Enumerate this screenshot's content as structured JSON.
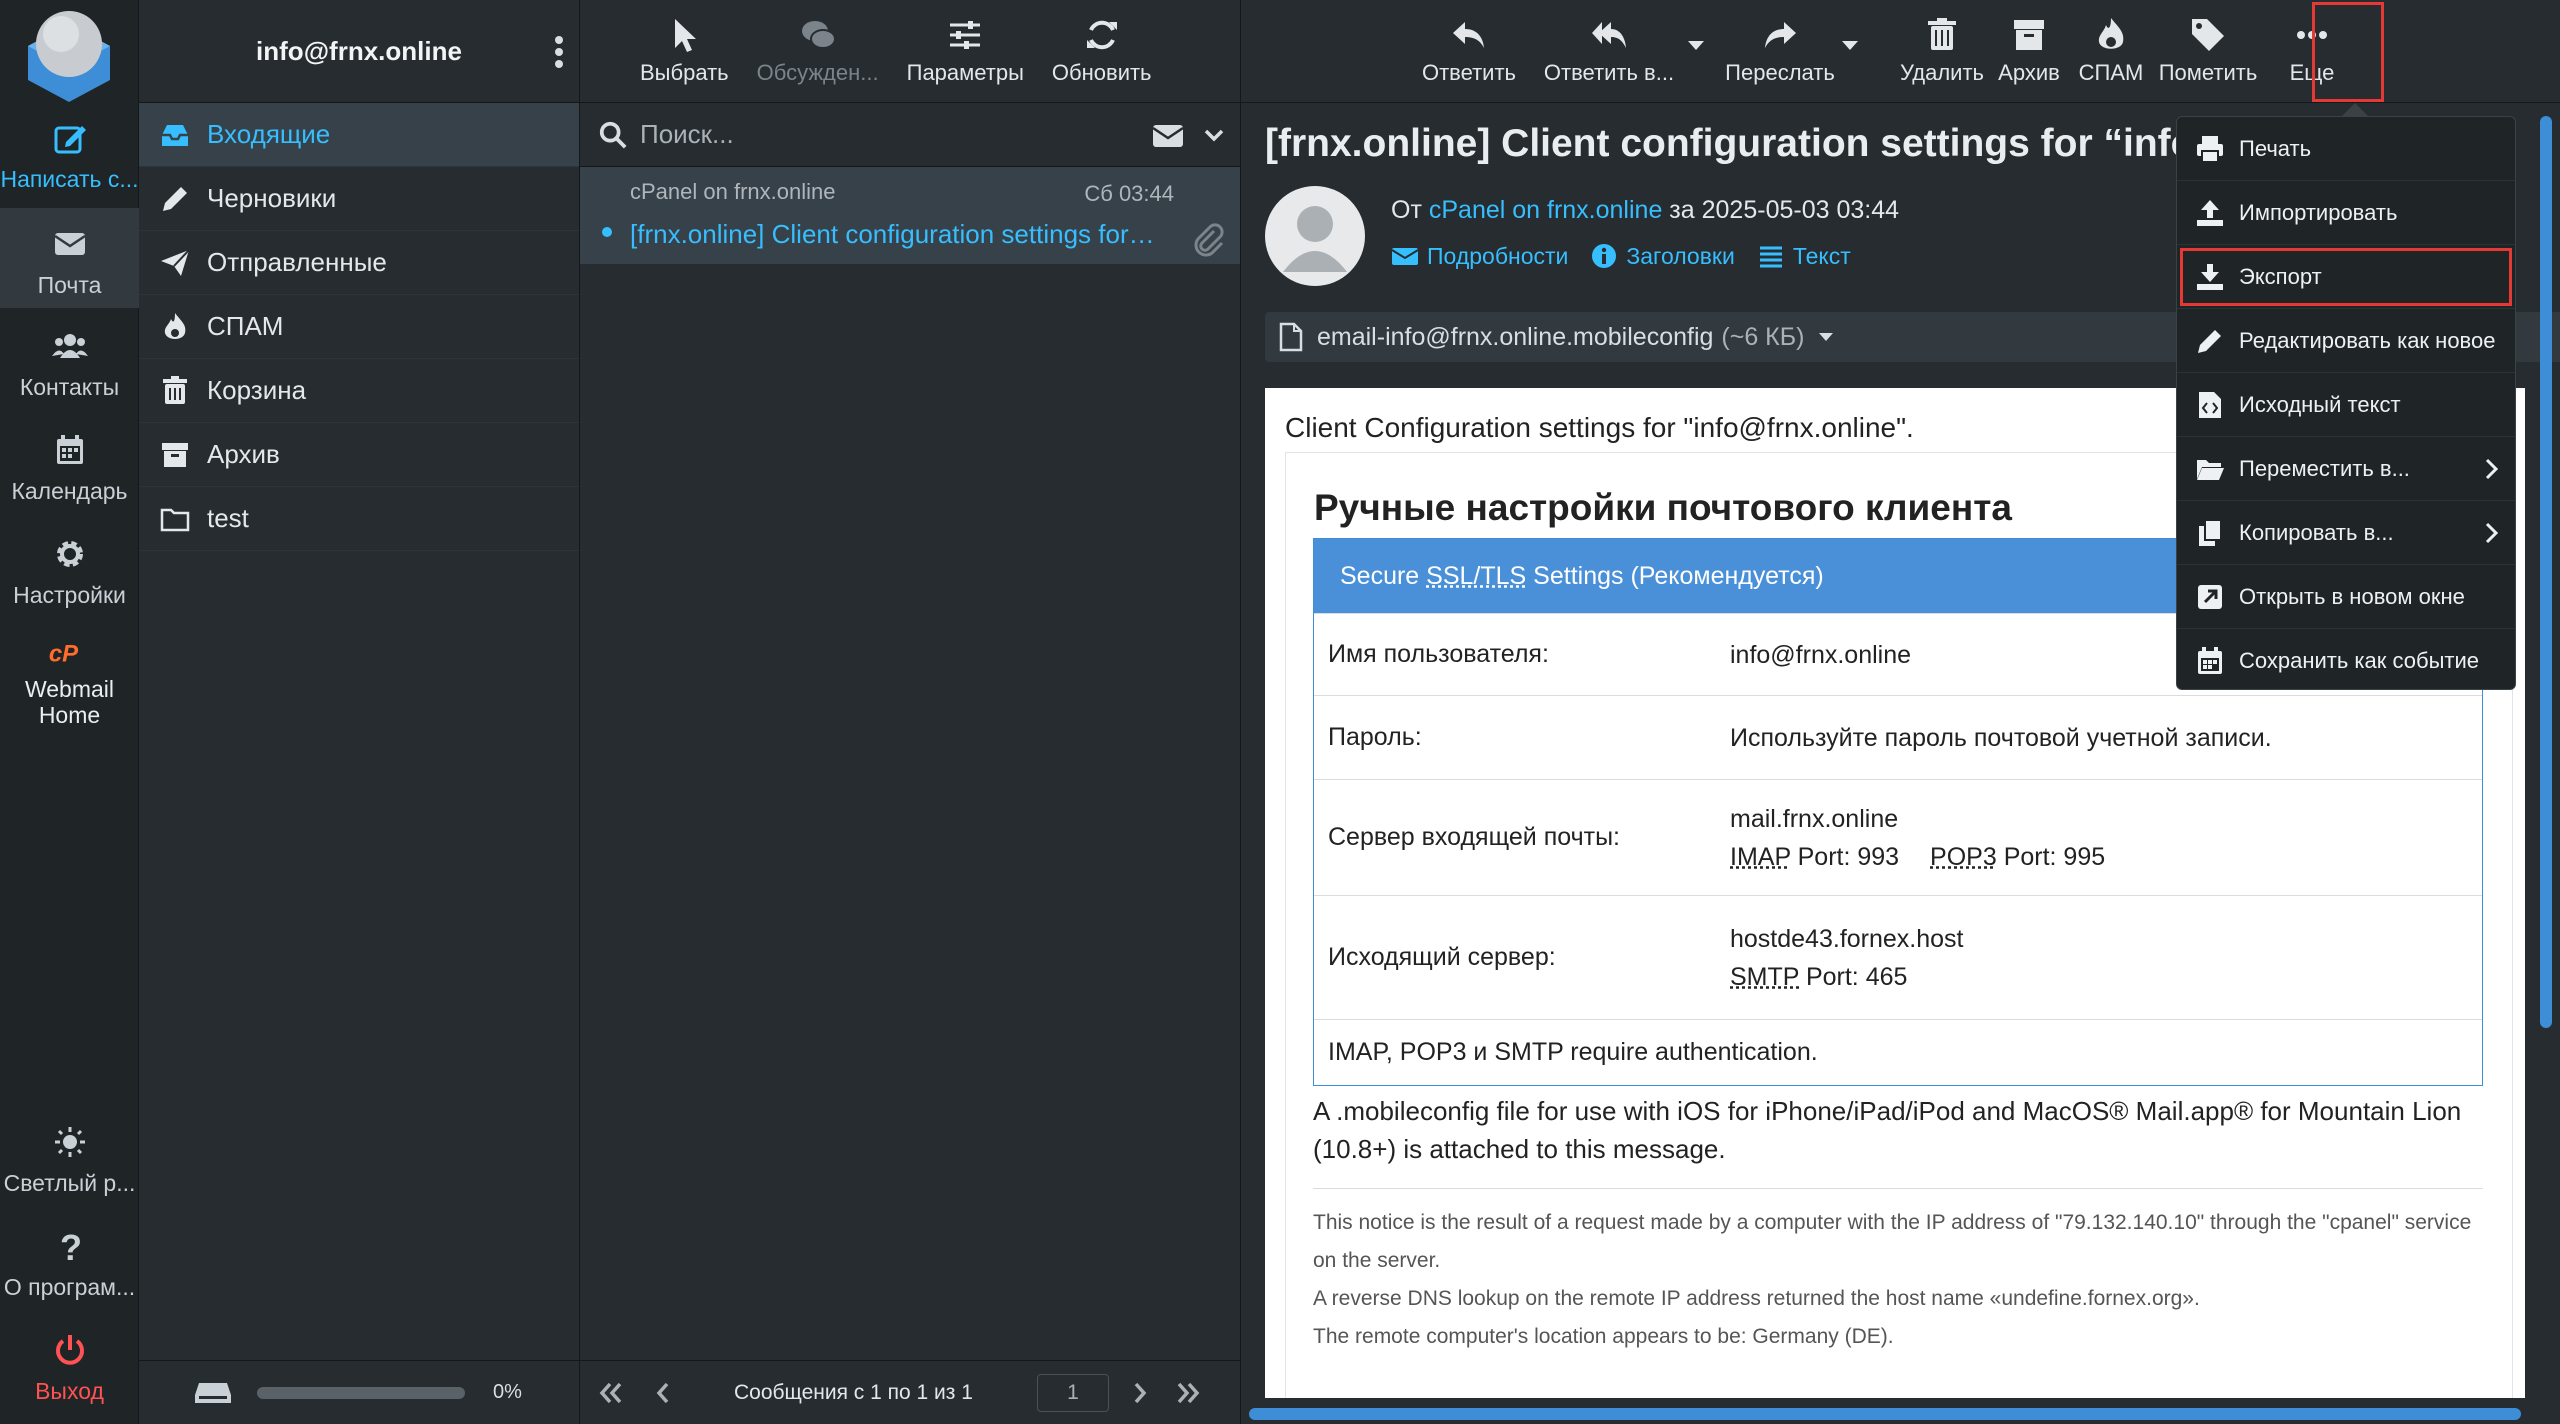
{
  "rail": {
    "compose": "Написать с...",
    "mail": "Почта",
    "contacts": "Контакты",
    "calendar": "Календарь",
    "settings": "Настройки",
    "webmail_home": "Webmail Home",
    "theme": "Светлый р...",
    "about": "О програм...",
    "logout": "Выход"
  },
  "folders": {
    "account": "info@frnx.online",
    "items": [
      {
        "label": "Входящие",
        "icon": "inbox-icon"
      },
      {
        "label": "Черновики",
        "icon": "pencil-icon"
      },
      {
        "label": "Отправленные",
        "icon": "paper-plane-icon"
      },
      {
        "label": "СПАМ",
        "icon": "fire-icon"
      },
      {
        "label": "Корзина",
        "icon": "trash-icon"
      },
      {
        "label": "Архив",
        "icon": "archive-icon"
      },
      {
        "label": "test",
        "icon": "folder-icon"
      }
    ],
    "quota": "0%"
  },
  "list": {
    "toolbar": {
      "select": "Выбрать",
      "threads": "Обсужден...",
      "options": "Параметры",
      "refresh": "Обновить"
    },
    "search_placeholder": "Поиск...",
    "messages": [
      {
        "from": "cPanel on frnx.online",
        "date": "Сб 03:44",
        "subject": "[frnx.online] Client configuration settings for “info@frnx.online”"
      }
    ],
    "count": "Сообщения с 1 по 1 из 1",
    "page": "1"
  },
  "view": {
    "toolbar": {
      "reply": "Ответить",
      "reply_all": "Ответить в...",
      "forward": "Переслать",
      "delete": "Удалить",
      "archive": "Архив",
      "spam": "СПАМ",
      "mark": "Пометить",
      "more": "Еще"
    },
    "subject": "[frnx.online] Client configuration settings for “info@frnx.online”",
    "from_prefix": "От",
    "from": "cPanel on frnx.online",
    "date_prefix": "за",
    "date": "2025-05-03 03:44",
    "details": "Подробности",
    "headers": "Заголовки",
    "text": "Текст",
    "attachment": {
      "name": "email-info@frnx.online.mobileconfig",
      "size": "(~6 КБ)"
    },
    "body": {
      "intro": "Client Configuration settings for \"info@frnx.online\".",
      "heading": "Ручные настройки почтового клиента",
      "table_head_pre": "Secure ",
      "table_head_abbr": "SSL/TLS",
      "table_head_post": " Settings (Рекомендуется)",
      "username_label": "Имя пользователя:",
      "username": "info@frnx.online",
      "password_label": "Пароль:",
      "password": "Используйте пароль почтовой учетной записи.",
      "incoming_label": "Сервер входящей почты:",
      "incoming_host": "mail.frnx.online",
      "imap": "IMAP",
      "imap_port": "Port: 993",
      "pop3": "POP3",
      "pop3_port": "Port: 995",
      "outgoing_label": "Исходящий сервер:",
      "outgoing_host": "hostde43.fornex.host",
      "smtp": "SMTP",
      "smtp_port": "Port: 465",
      "auth": "IMAP, POP3 и SMTP require authentication.",
      "para": "A .mobileconfig file for use with iOS for iPhone/iPad/iPod and MacOS® Mail.app® for Mountain Lion (10.8+) is attached to this message.",
      "notice_1": "This notice is the result of a request made by a computer with the IP address of \"79.132.140.10\" through the \"cpanel\" service on the server.",
      "notice_2": "A reverse DNS lookup on the remote IP address returned the host name «undefine.fornex.org».",
      "notice_3": "The remote computer's location appears to be: Germany (DE)."
    }
  },
  "menu": {
    "items": [
      {
        "label": "Печать",
        "icon": "printer-icon"
      },
      {
        "label": "Импортировать",
        "icon": "upload-icon"
      },
      {
        "label": "Экспорт",
        "icon": "download-icon"
      },
      {
        "label": "Редактировать как новое",
        "icon": "pencil-icon"
      },
      {
        "label": "Исходный текст",
        "icon": "source-file-icon"
      },
      {
        "label": "Переместить в...",
        "icon": "folder-open-icon"
      },
      {
        "label": "Копировать в...",
        "icon": "copy-icon"
      },
      {
        "label": "Открыть в новом окне",
        "icon": "external-window-icon"
      },
      {
        "label": "Сохранить как событие",
        "icon": "calendar-icon"
      }
    ]
  },
  "colors": {
    "accent": "#37beff",
    "highlight": "#e53935",
    "logout": "#ff5252"
  }
}
